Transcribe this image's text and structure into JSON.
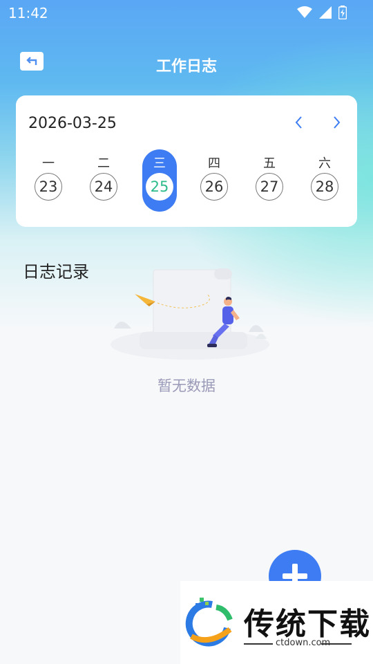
{
  "status_bar": {
    "time": "11:42"
  },
  "header": {
    "title": "工作日志"
  },
  "calendar": {
    "date": "2026-03-25",
    "days": [
      {
        "weekday": "一",
        "date": "23",
        "selected": false
      },
      {
        "weekday": "二",
        "date": "24",
        "selected": false
      },
      {
        "weekday": "三",
        "date": "25",
        "selected": true
      },
      {
        "weekday": "四",
        "date": "26",
        "selected": false
      },
      {
        "weekday": "五",
        "date": "27",
        "selected": false
      },
      {
        "weekday": "六",
        "date": "28",
        "selected": false
      }
    ]
  },
  "section": {
    "title": "日志记录"
  },
  "empty_state": {
    "text": "暂无数据",
    "icon": "empty-illustration"
  },
  "fab": {
    "icon": "plus-icon"
  },
  "watermark": {
    "brand": "传统下载",
    "domain": "ctdown.com"
  },
  "colors": {
    "accent": "#3d7cf2",
    "selected_date_text": "#2dbb8a",
    "empty_text": "#9a9ab8"
  }
}
